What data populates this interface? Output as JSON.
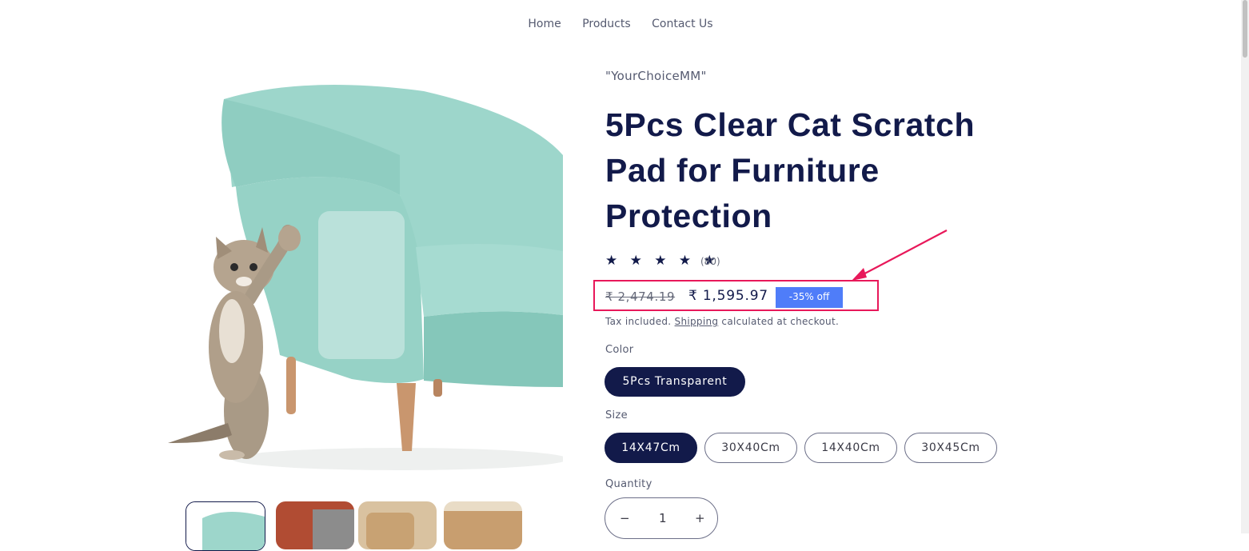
{
  "nav": {
    "items": [
      "Home",
      "Products",
      "Contact Us"
    ]
  },
  "product": {
    "vendor": "\"YourChoiceMM\"",
    "title": "5Pcs Clear Cat Scratch Pad for Furniture Protection",
    "rating": {
      "stars": "★ ★ ★ ★ ★",
      "value": 5,
      "count": "(80)"
    },
    "price": {
      "compare_at": "₹ 2,474.19",
      "current": "₹ 1,595.97",
      "badge": "-35% off"
    },
    "tax_note": {
      "prefix": "Tax included.",
      "link": "Shipping",
      "suffix": "calculated at checkout."
    },
    "color": {
      "label": "Color",
      "options": [
        "5Pcs Transparent"
      ],
      "selected": "5Pcs Transparent"
    },
    "size": {
      "label": "Size",
      "options": [
        "14X47Cm",
        "30X40Cm",
        "14X40Cm",
        "30X45Cm"
      ],
      "selected": "14X47Cm"
    },
    "quantity": {
      "label": "Quantity",
      "value": "1",
      "minus": "−",
      "plus": "+"
    }
  },
  "colors": {
    "brand": "#121a4a",
    "badge": "#4f7df9",
    "annotation": "#e8185a",
    "sofa": "#8fd0c4"
  },
  "icons": [
    "arrow-annotation-icon",
    "minus-icon",
    "plus-icon"
  ]
}
